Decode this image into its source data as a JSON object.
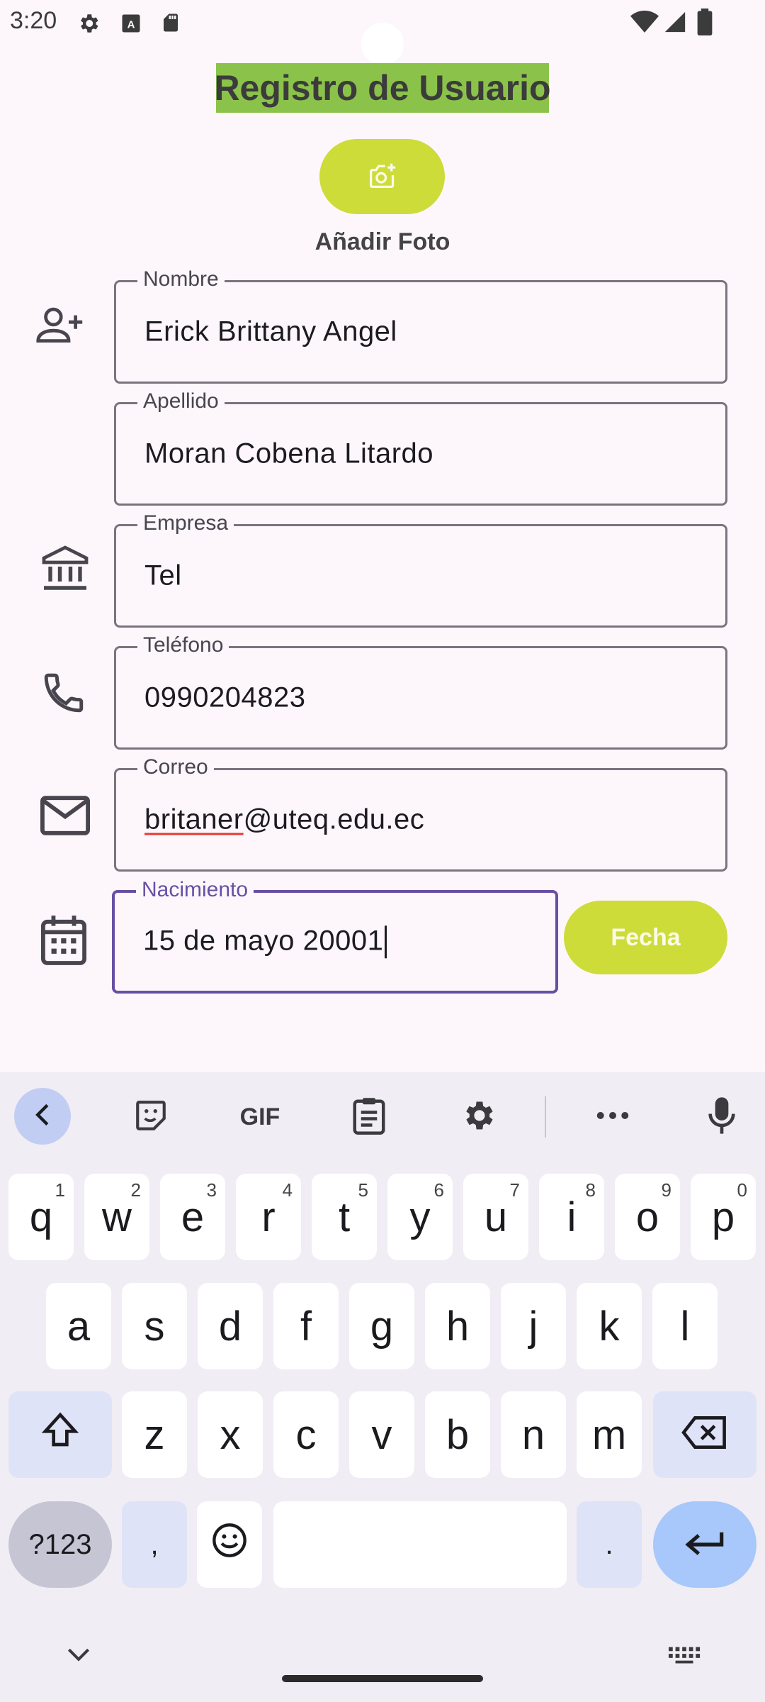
{
  "status_bar": {
    "time": "3:20"
  },
  "header": {
    "title": "Registro de Usuario",
    "photo_label": "Añadir Foto"
  },
  "fields": [
    {
      "label": "Nombre",
      "value": "Erick Brittany Angel"
    },
    {
      "label": "Apellido",
      "value": "Moran Cobena Litardo"
    },
    {
      "label": "Empresa",
      "value": "Tel"
    },
    {
      "label": "Teléfono",
      "value": "0990204823"
    },
    {
      "label": "Correo",
      "value_underlined": "britaner",
      "value_rest": "@uteq.edu.ec"
    },
    {
      "label": "Nacimiento",
      "value": "15 de mayo 20001"
    }
  ],
  "date_button": {
    "label": "Fecha"
  },
  "keyboard": {
    "toolbar": [
      "back-icon",
      "sticker-icon",
      "GIF",
      "clipboard-icon",
      "settings-icon",
      "more-icon",
      "mic-icon"
    ],
    "gif_label": "GIF",
    "row1": [
      {
        "k": "q",
        "h": "1"
      },
      {
        "k": "w",
        "h": "2"
      },
      {
        "k": "e",
        "h": "3"
      },
      {
        "k": "r",
        "h": "4"
      },
      {
        "k": "t",
        "h": "5"
      },
      {
        "k": "y",
        "h": "6"
      },
      {
        "k": "u",
        "h": "7"
      },
      {
        "k": "i",
        "h": "8"
      },
      {
        "k": "o",
        "h": "9"
      },
      {
        "k": "p",
        "h": "0"
      }
    ],
    "row2": [
      "a",
      "s",
      "d",
      "f",
      "g",
      "h",
      "j",
      "k",
      "l"
    ],
    "row3": [
      "z",
      "x",
      "c",
      "v",
      "b",
      "n",
      "m"
    ],
    "symbols_label": "?123",
    "comma_label": ",",
    "period_label": "."
  },
  "colors": {
    "accent": "#6750a4",
    "button": "#cddc39",
    "title_bg": "#8bc34a"
  }
}
